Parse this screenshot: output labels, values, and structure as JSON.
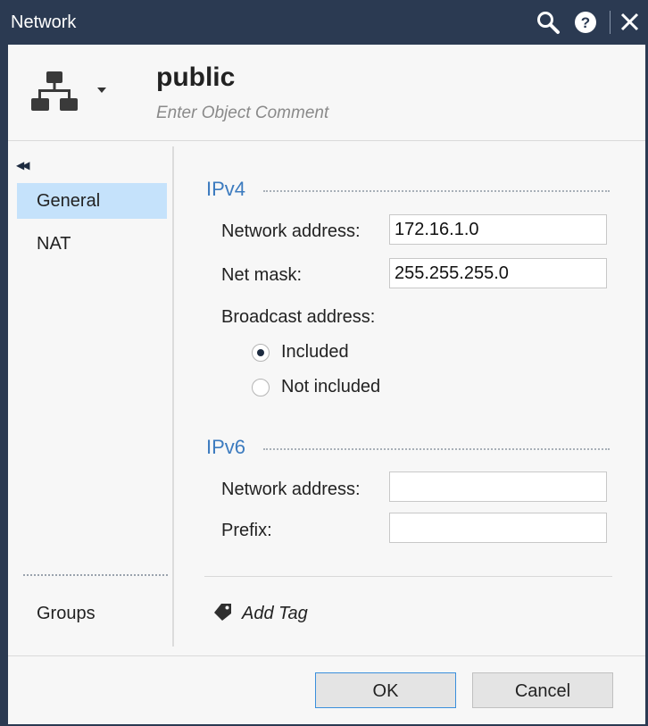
{
  "window": {
    "title": "Network"
  },
  "titlebar": {
    "icons": [
      "search-icon",
      "help-icon",
      "close-icon"
    ]
  },
  "object": {
    "icon": "network-tree-icon",
    "name": "public",
    "comment_placeholder": "Enter Object Comment"
  },
  "sidebar": {
    "collapse_icon": "double-chevron-left-icon",
    "items": [
      {
        "label": "General",
        "active": true
      },
      {
        "label": "NAT",
        "active": false
      }
    ],
    "groups_label": "Groups"
  },
  "ipv4": {
    "title": "IPv4",
    "network_address_label": "Network address:",
    "network_address_value": "172.16.1.0",
    "net_mask_label": "Net mask:",
    "net_mask_value": "255.255.255.0",
    "broadcast_label": "Broadcast address:",
    "broadcast_options": [
      {
        "label": "Included",
        "checked": true
      },
      {
        "label": "Not included",
        "checked": false
      }
    ]
  },
  "ipv6": {
    "title": "IPv6",
    "network_address_label": "Network address:",
    "network_address_value": "",
    "prefix_label": "Prefix:",
    "prefix_value": ""
  },
  "tags": {
    "icon": "tag-icon",
    "add_label": "Add Tag"
  },
  "footer": {
    "ok_label": "OK",
    "cancel_label": "Cancel"
  },
  "colors": {
    "titlebar": "#2b3a52",
    "accent": "#3c7bbf",
    "selected": "#c5e2fb",
    "ok_border": "#3a8fdc"
  }
}
